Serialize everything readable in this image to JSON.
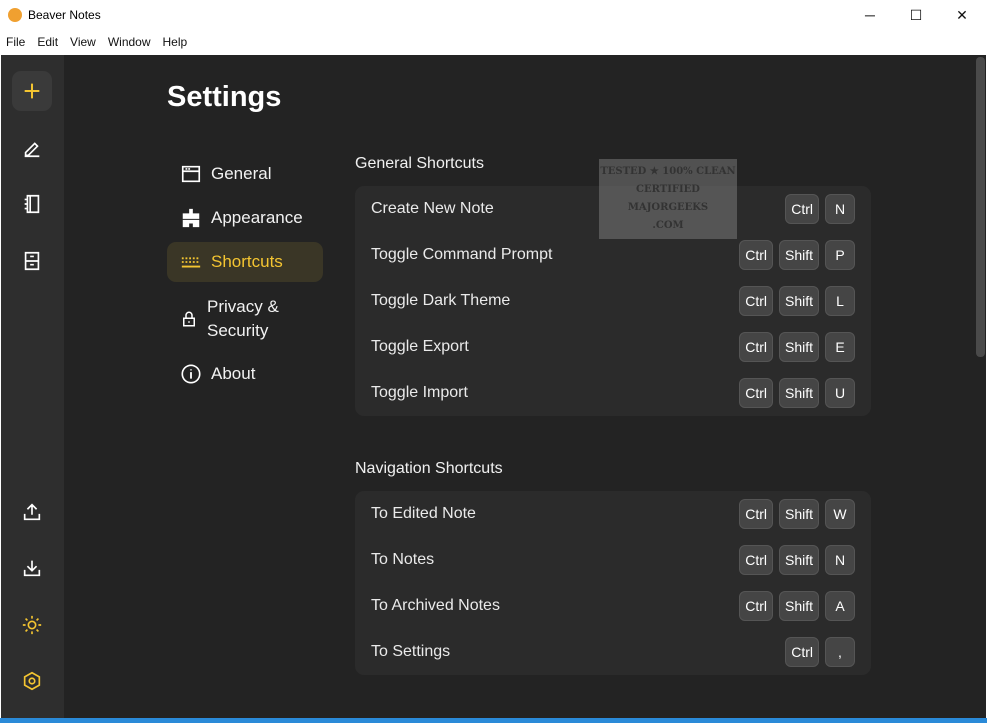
{
  "window": {
    "title": "Beaver Notes",
    "minimize": "─",
    "maximize": "☐",
    "close": "✕"
  },
  "menu": [
    "File",
    "Edit",
    "View",
    "Window",
    "Help"
  ],
  "page": {
    "title": "Settings"
  },
  "nav": [
    {
      "label": "General"
    },
    {
      "label": "Appearance"
    },
    {
      "label": "Shortcuts"
    },
    {
      "label": "Privacy & Security"
    },
    {
      "label": "About"
    }
  ],
  "watermark": [
    "TESTED ★ 100% CLEAN",
    "CERTIFIED",
    "MAJORGEEKS",
    ".COM"
  ],
  "sections": [
    {
      "title": "General Shortcuts",
      "rows": [
        {
          "label": "Create New Note",
          "keys": [
            "Ctrl",
            "N"
          ]
        },
        {
          "label": "Toggle Command Prompt",
          "keys": [
            "Ctrl",
            "Shift",
            "P"
          ]
        },
        {
          "label": "Toggle Dark Theme",
          "keys": [
            "Ctrl",
            "Shift",
            "L"
          ]
        },
        {
          "label": "Toggle Export",
          "keys": [
            "Ctrl",
            "Shift",
            "E"
          ]
        },
        {
          "label": "Toggle Import",
          "keys": [
            "Ctrl",
            "Shift",
            "U"
          ]
        }
      ]
    },
    {
      "title": "Navigation Shortcuts",
      "rows": [
        {
          "label": "To Edited Note",
          "keys": [
            "Ctrl",
            "Shift",
            "W"
          ]
        },
        {
          "label": "To Notes",
          "keys": [
            "Ctrl",
            "Shift",
            "N"
          ]
        },
        {
          "label": "To Archived Notes",
          "keys": [
            "Ctrl",
            "Shift",
            "A"
          ]
        },
        {
          "label": "To Settings",
          "keys": [
            "Ctrl",
            ","
          ]
        }
      ]
    },
    {
      "title": "Editor Shortcuts",
      "rows": []
    }
  ],
  "colors": {
    "accent": "#f4c531",
    "background": "#232323",
    "rail": "#2e2e2e",
    "card": "#2b2b2b"
  }
}
